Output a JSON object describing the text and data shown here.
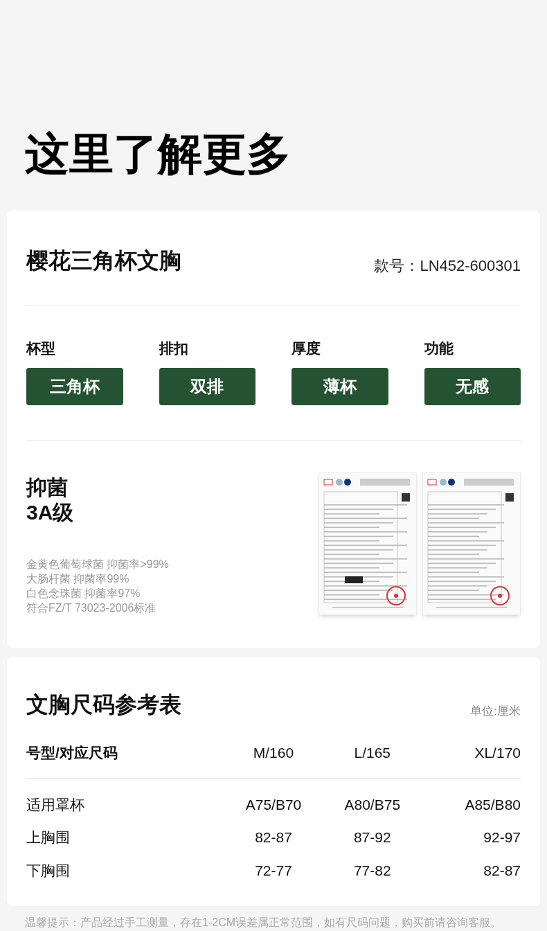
{
  "heading": "这里了解更多",
  "product": {
    "name": "樱花三角杯文胸",
    "model": "款号：LN452-600301",
    "attributes": [
      {
        "label": "杯型",
        "value": "三角杯"
      },
      {
        "label": "排扣",
        "value": "双排"
      },
      {
        "label": "厚度",
        "value": "薄杯"
      },
      {
        "label": "功能",
        "value": "无感"
      }
    ],
    "antibacterial": {
      "title": "抑菌",
      "grade": "3A级",
      "details": [
        "金黄色葡萄球菌 抑菌率>99%",
        "大肠杆菌 抑菌率99%",
        "白色念珠菌 抑菌率97%",
        "符合FZ/T 73023-2006标准"
      ]
    }
  },
  "size_chart": {
    "title": "文胸尺码参考表",
    "unit": "单位:厘米",
    "columns": [
      "号型/对应尺码",
      "M/160",
      "L/165",
      "XL/170"
    ],
    "rows": [
      [
        "适用罩杯",
        "A75/B70",
        "A80/B75",
        "A85/B80"
      ],
      [
        "上胸围",
        "82-87",
        "87-92",
        "92-97"
      ],
      [
        "下胸围",
        "72-77",
        "77-82",
        "82-87"
      ]
    ]
  },
  "footnote": "温馨提示：产品经过手工测量，存在1-2CM误差属正常范围，如有尺码问题，购买前请咨询客服。"
}
